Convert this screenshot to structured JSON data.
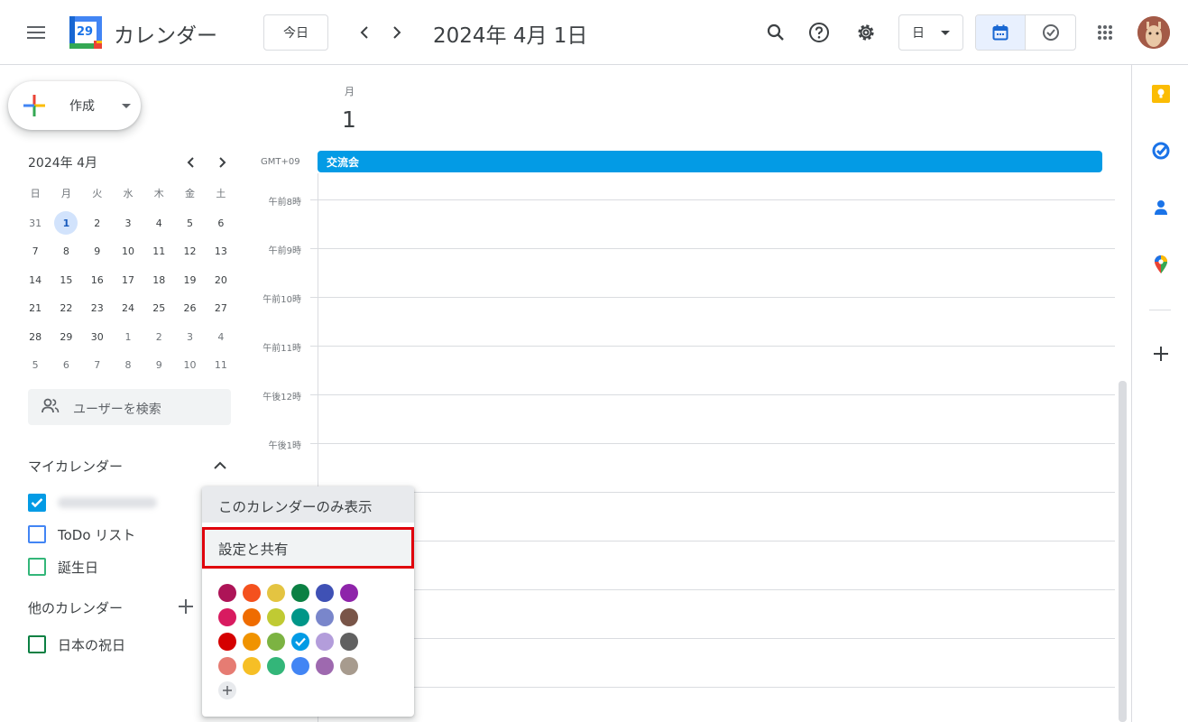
{
  "header": {
    "app_title": "カレンダー",
    "logo_day": "29",
    "today_label": "今日",
    "date_title": "2024年 4月 1日",
    "view_select": "日"
  },
  "sidebar": {
    "create_label": "作成",
    "mini_calendar": {
      "title": "2024年 4月",
      "weekdays": [
        "日",
        "月",
        "火",
        "水",
        "木",
        "金",
        "土"
      ],
      "weeks": [
        [
          "31",
          "1",
          "2",
          "3",
          "4",
          "5",
          "6"
        ],
        [
          "7",
          "8",
          "9",
          "10",
          "11",
          "12",
          "13"
        ],
        [
          "14",
          "15",
          "16",
          "17",
          "18",
          "19",
          "20"
        ],
        [
          "21",
          "22",
          "23",
          "24",
          "25",
          "26",
          "27"
        ],
        [
          "28",
          "29",
          "30",
          "1",
          "2",
          "3",
          "4"
        ],
        [
          "5",
          "6",
          "7",
          "8",
          "9",
          "10",
          "11"
        ]
      ],
      "selected": "1"
    },
    "people_search_placeholder": "ユーザーを検索",
    "my_calendars_title": "マイカレンダー",
    "my_calendars": [
      {
        "label": "",
        "color": "#039be5",
        "checked": true
      },
      {
        "label": "ToDo リスト",
        "color": "#4285f4",
        "checked": false
      },
      {
        "label": "誕生日",
        "color": "#33b679",
        "checked": false
      }
    ],
    "other_calendars_title": "他のカレンダー",
    "other_calendars": [
      {
        "label": "日本の祝日",
        "color": "#0b8043",
        "checked": false
      }
    ]
  },
  "main": {
    "day_name": "月",
    "day_number": "1",
    "timezone": "GMT+09",
    "allday_event": "交流会",
    "hours": [
      "午前8時",
      "午前9時",
      "午前10時",
      "午前11時",
      "午後12時",
      "午後1時"
    ]
  },
  "popup": {
    "show_only": "このカレンダーのみ表示",
    "settings": "設定と共有",
    "colors": [
      [
        "#ad1457",
        "#f4511e",
        "#e4c441",
        "#0b8043",
        "#3f51b5",
        "#8e24aa"
      ],
      [
        "#d81b60",
        "#ef6c00",
        "#c0ca33",
        "#009688",
        "#7986cb",
        "#795548"
      ],
      [
        "#d50000",
        "#f09300",
        "#7cb342",
        "#039be5",
        "#b39ddb",
        "#616161"
      ],
      [
        "#e67c73",
        "#f6bf26",
        "#33b679",
        "#4285f4",
        "#9e69af",
        "#a79b8e"
      ]
    ],
    "selected_color": "#039be5"
  }
}
